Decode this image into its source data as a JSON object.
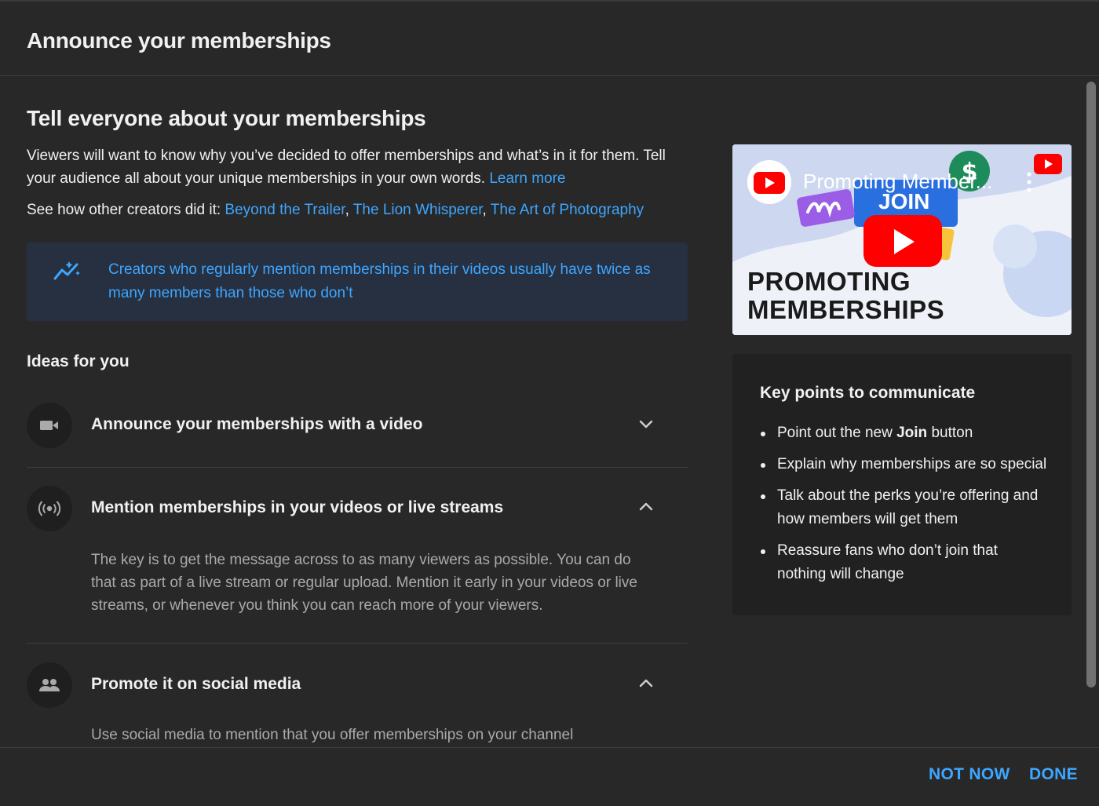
{
  "dialog": {
    "title": "Announce your memberships"
  },
  "main": {
    "title": "Tell everyone about your memberships",
    "intro": "Viewers will want to know why you’ve decided to offer memberships and what’s in it for them. Tell your audience all about your unique memberships in your own words.",
    "learn_more": "Learn more",
    "see_prefix": "See how other creators did it:",
    "examples": [
      "Beyond the Trailer",
      "The Lion Whisperer",
      "The Art of Photography"
    ],
    "separator": ",",
    "tip": "Creators who regularly mention memberships in their videos usually have twice as many members than those who don’t",
    "ideas_heading": "Ideas for you",
    "ideas": [
      {
        "title": "Announce your memberships with a video",
        "icon": "videocam-icon",
        "expanded": false,
        "body": ""
      },
      {
        "title": "Mention memberships in your videos or live streams",
        "icon": "live-broadcast-icon",
        "expanded": true,
        "body": "The key is to get the message across to as many viewers as possible. You can do that as part of a live stream or regular upload. Mention it early in your videos or live streams, or whenever you think you can reach more of your viewers."
      },
      {
        "title": "Promote it on social media",
        "icon": "people-icon",
        "expanded": true,
        "body": "Use social media to mention that you offer memberships on your channel"
      }
    ]
  },
  "side": {
    "video": {
      "title": "Promoting Member...",
      "join_label": "JOIN",
      "big_text_line1": "PROMOTING",
      "big_text_line2": "MEMBERSHIPS"
    },
    "key_points_title": "Key points to communicate",
    "key_points": [
      {
        "before": "Point out the new ",
        "bold": "Join",
        "after": " button"
      },
      {
        "before": "Explain why memberships are so special",
        "bold": "",
        "after": ""
      },
      {
        "before": "Talk about the perks you’re offering and how members will get them",
        "bold": "",
        "after": ""
      },
      {
        "before": "Reassure fans who don’t join that nothing will change",
        "bold": "",
        "after": ""
      }
    ]
  },
  "footer": {
    "not_now": "NOT NOW",
    "done": "DONE"
  },
  "colors": {
    "accent": "#3ea6ff",
    "background": "#282828",
    "tip_bg": "#263040",
    "youtube_red": "#ff0000"
  }
}
